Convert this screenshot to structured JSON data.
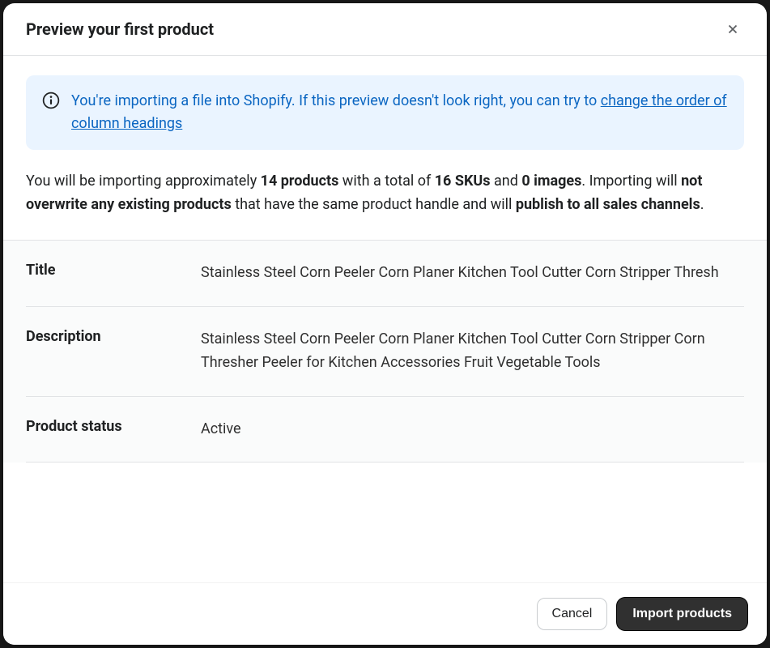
{
  "modal": {
    "title": "Preview your first product"
  },
  "banner": {
    "text_before_link": "You're importing a file into Shopify. If this preview doesn't look right, you can try to ",
    "link": "change the order of column headings"
  },
  "summary": {
    "s1": "You will be importing approximately ",
    "products": "14 products",
    "s2": " with a total of ",
    "skus": "16 SKUs",
    "s3": " and ",
    "images": "0 images",
    "s4": ". Importing will ",
    "overwrite": "not overwrite any existing products",
    "s5": " that have the same product handle and will ",
    "publish": "publish to all sales channels",
    "s6": "."
  },
  "preview": {
    "rows": [
      {
        "label": "Title",
        "value": "Stainless Steel Corn Peeler Corn Planer Kitchen Tool Cutter Corn Stripper Thresh"
      },
      {
        "label": "Description",
        "value": "Stainless Steel Corn Peeler Corn Planer Kitchen Tool Cutter Corn Stripper Corn Thresher Peeler for Kitchen Accessories Fruit Vegetable Tools"
      },
      {
        "label": "Product status",
        "value": "Active"
      }
    ]
  },
  "footer": {
    "cancel": "Cancel",
    "import": "Import products"
  }
}
